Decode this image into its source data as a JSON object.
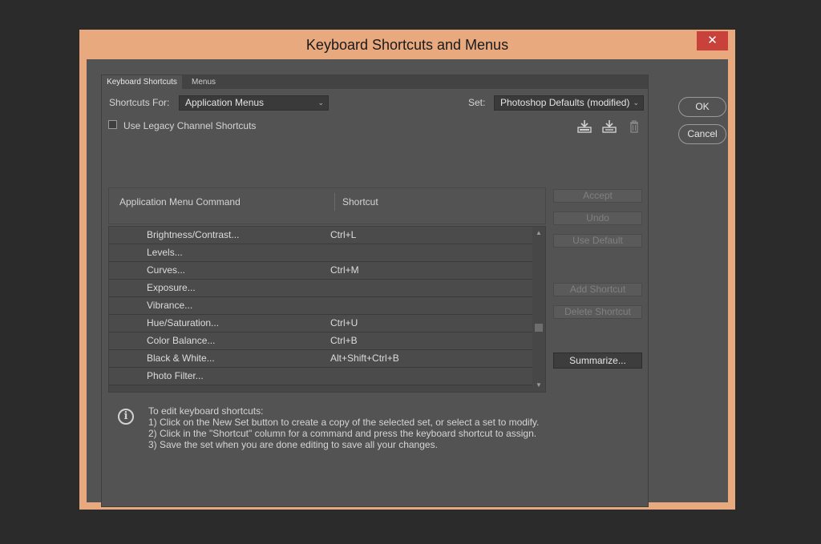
{
  "window": {
    "title": "Keyboard Shortcuts and Menus",
    "close_label": "✕"
  },
  "tabs": [
    {
      "label": "Keyboard Shortcuts",
      "active": true
    },
    {
      "label": "Menus",
      "active": false
    }
  ],
  "shortcuts_for": {
    "label": "Shortcuts For:",
    "value": "Application Menus"
  },
  "set": {
    "label": "Set:",
    "value": "Photoshop Defaults (modified)"
  },
  "legacy_checkbox": {
    "label": "Use Legacy Channel Shortcuts",
    "checked": false
  },
  "set_icons": [
    "save-set-icon",
    "new-set-icon",
    "delete-set-icon"
  ],
  "table": {
    "headers": {
      "command": "Application Menu Command",
      "shortcut": "Shortcut"
    },
    "rows": [
      {
        "command": "Brightness/Contrast...",
        "shortcut": "Ctrl+L"
      },
      {
        "command": "Levels...",
        "shortcut": ""
      },
      {
        "command": "Curves...",
        "shortcut": "Ctrl+M"
      },
      {
        "command": "Exposure...",
        "shortcut": ""
      },
      {
        "command": "Vibrance...",
        "shortcut": ""
      },
      {
        "command": "Hue/Saturation...",
        "shortcut": "Ctrl+U"
      },
      {
        "command": "Color Balance...",
        "shortcut": "Ctrl+B"
      },
      {
        "command": "Black & White...",
        "shortcut": "Alt+Shift+Ctrl+B"
      },
      {
        "command": "Photo Filter...",
        "shortcut": ""
      }
    ]
  },
  "side_buttons": {
    "accept": "Accept",
    "undo": "Undo",
    "use_default": "Use Default",
    "add_shortcut": "Add Shortcut",
    "delete_shortcut": "Delete Shortcut",
    "summarize": "Summarize..."
  },
  "info": {
    "icon": "info-icon",
    "lines": [
      "To edit keyboard shortcuts:",
      "1) Click on the New Set button to create a copy of the selected set, or select a set to modify.",
      "2) Click in the \"Shortcut\" column for a command and press the keyboard shortcut to assign.",
      "3) Save the set when you are done editing to save all your changes."
    ]
  },
  "dialog_buttons": {
    "ok": "OK",
    "cancel": "Cancel"
  },
  "colors": {
    "frame": "#e8a97f",
    "close": "#c8413a",
    "dialog_bg": "#535353",
    "backdrop": "#2b2b2b"
  }
}
